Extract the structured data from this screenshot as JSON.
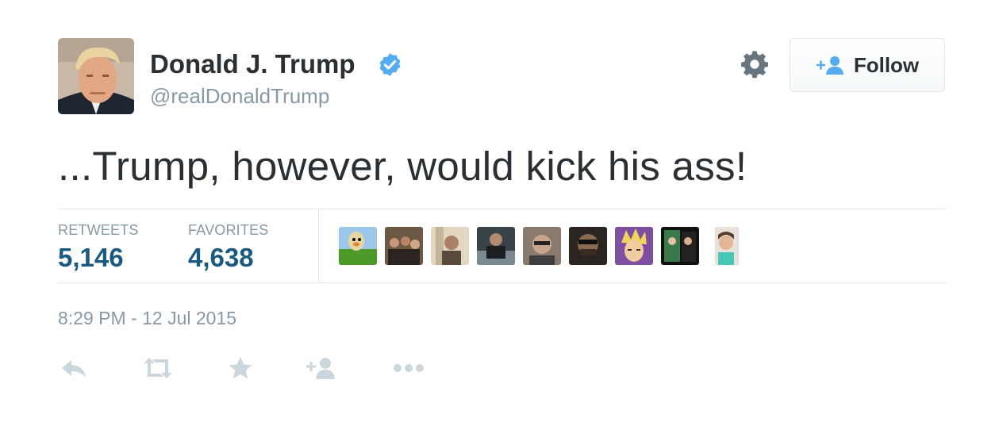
{
  "user": {
    "name": "Donald J. Trump",
    "handle": "@realDonaldTrump",
    "avatar_icon": "profile-photo",
    "verified_icon": "verified-badge-icon"
  },
  "header": {
    "settings_icon": "gear-icon",
    "follow_label": "Follow",
    "follow_icon": "follow-user-icon"
  },
  "tweet": {
    "text": "...Trump, however, would kick his ass!",
    "timestamp": "8:29 PM - 12 Jul 2015"
  },
  "stats": {
    "retweets_label": "RETWEETS",
    "retweets_value": "5,146",
    "favorites_label": "FAVORITES",
    "favorites_value": "4,638"
  },
  "favoriters": [
    "favoriter-avatar-1",
    "favoriter-avatar-2",
    "favoriter-avatar-3",
    "favoriter-avatar-4",
    "favoriter-avatar-5",
    "favoriter-avatar-6",
    "favoriter-avatar-7",
    "favoriter-avatar-8",
    "favoriter-avatar-9"
  ],
  "actions": [
    "reply-icon",
    "retweet-icon",
    "favorite-icon",
    "follow-icon",
    "more-icon"
  ],
  "colors": {
    "text": "#292f33",
    "muted": "#8899a6",
    "stat_value": "#1a5a80",
    "verified": "#55acee",
    "divider": "#e1e8ed",
    "action_icon": "#ccd6dd"
  }
}
